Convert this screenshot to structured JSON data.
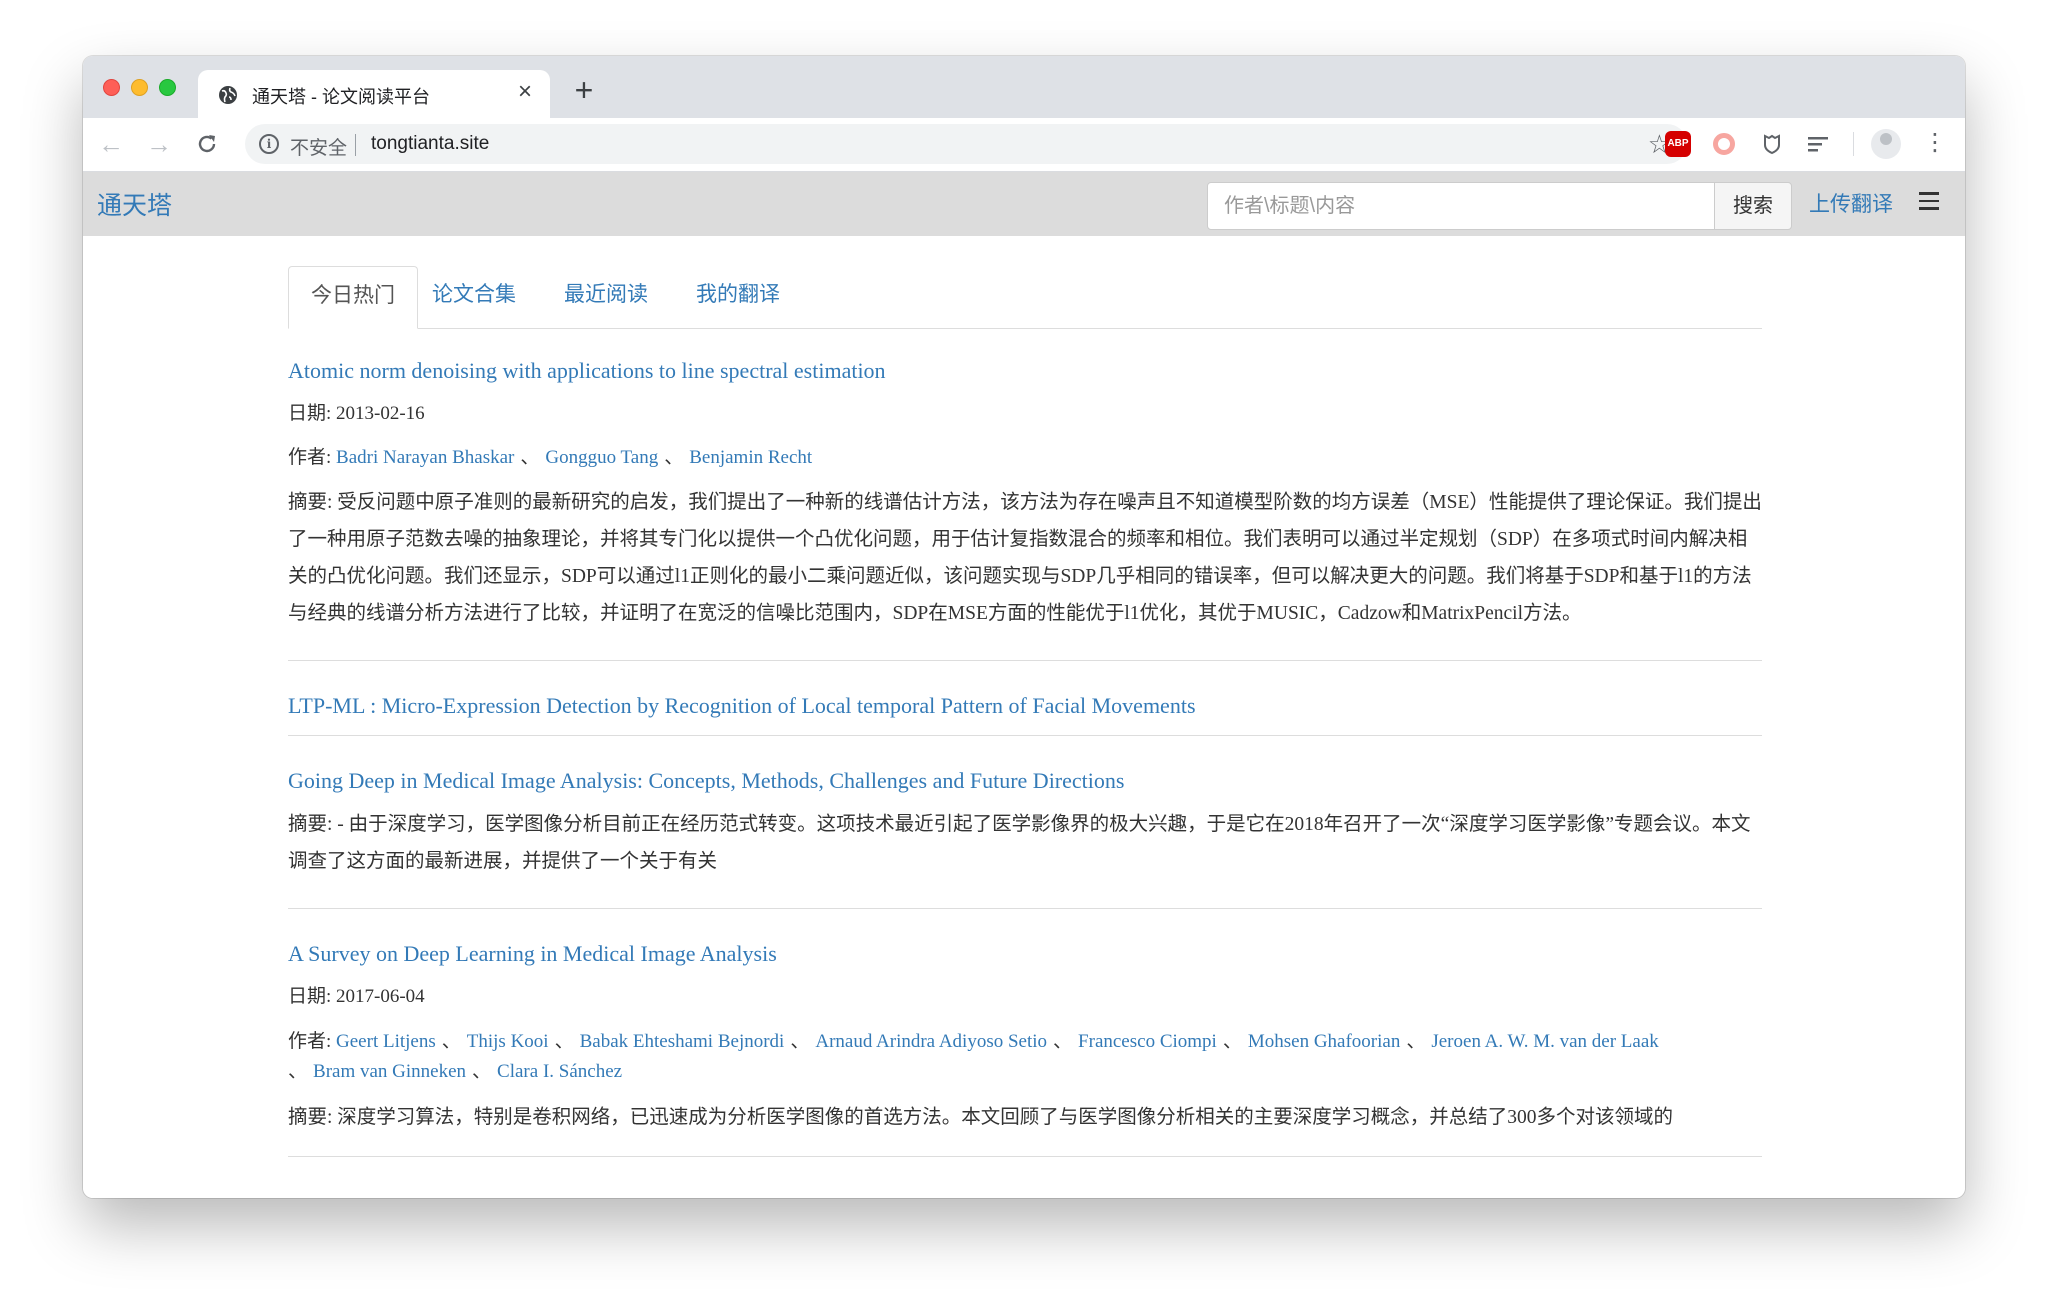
{
  "browser": {
    "tab_title": "通天塔 - 论文阅读平台",
    "tab_close": "×",
    "new_tab": "+",
    "security_label": "不安全",
    "url": "tongtianta.site",
    "extension_abp": "ABP"
  },
  "site": {
    "brand": "通天塔",
    "search_placeholder": "作者\\标题\\内容",
    "search_value": "",
    "search_button": "搜索",
    "upload_label": "上传翻译",
    "link_color": "#337ab7"
  },
  "tabs": [
    {
      "label": "今日热门",
      "active": true
    },
    {
      "label": "论文合集",
      "active": false
    },
    {
      "label": "最近阅读",
      "active": false
    },
    {
      "label": "我的翻译",
      "active": false
    }
  ],
  "labels": {
    "date": "日期:",
    "authors": "作者:",
    "abstract": "摘要:",
    "author_separator": "、"
  },
  "papers": [
    {
      "title": "Atomic norm denoising with applications to line spectral estimation",
      "date": "2013-02-16",
      "authors": [
        "Badri Narayan Bhaskar",
        "Gongguo Tang",
        "Benjamin Recht"
      ],
      "abstract": "受反问题中原子准则的最新研究的启发，我们提出了一种新的线谱估计方法，该方法为存在噪声且不知道模型阶数的均方误差（MSE）性能提供了理论保证。我们提出了一种用原子范数去噪的抽象理论，并将其专门化以提供一个凸优化问题，用于估计复指数混合的频率和相位。我们表明可以通过半定规划（SDP）在多项式时间内解决相关的凸优化问题。我们还显示，SDP可以通过l1正则化的最小二乘问题近似，该问题实现与SDP几乎相同的错误率，但可以解决更大的问题。我们将基于SDP和基于l1的方法与经典的线谱分析方法进行了比较，并证明了在宽泛的信噪比范围内，SDP在MSE方面的性能优于l1优化，其优于MUSIC，Cadzow和MatrixPencil方法。"
    },
    {
      "title": "LTP-ML : Micro-Expression Detection by Recognition of Local temporal Pattern of Facial Movements"
    },
    {
      "title": "Going Deep in Medical Image Analysis: Concepts, Methods, Challenges and Future Directions",
      "abstract": "- 由于深度学习，医学图像分析目前正在经历范式转变。这项技术最近引起了医学影像界的极大兴趣，于是它在2018年召开了一次“深度学习医学影像”专题会议。本文调查了这方面的最新进展，并提供了一个关于有关"
    },
    {
      "title": "A Survey on Deep Learning in Medical Image Analysis",
      "date": "2017-06-04",
      "authors": [
        "Geert Litjens",
        "Thijs Kooi",
        "Babak Ehteshami Bejnordi",
        "Arnaud Arindra Adiyoso Setio",
        "Francesco Ciompi",
        "Mohsen Ghafoorian",
        "Jeroen A. W. M. van der Laak",
        "Bram van Ginneken",
        "Clara I. Sánchez"
      ],
      "abstract": "深度学习算法，特别是卷积网络，已迅速成为分析医学图像的首选方法。本文回顾了与医学图像分析相关的主要深度学习概念，并总结了300多个对该领域的"
    }
  ]
}
